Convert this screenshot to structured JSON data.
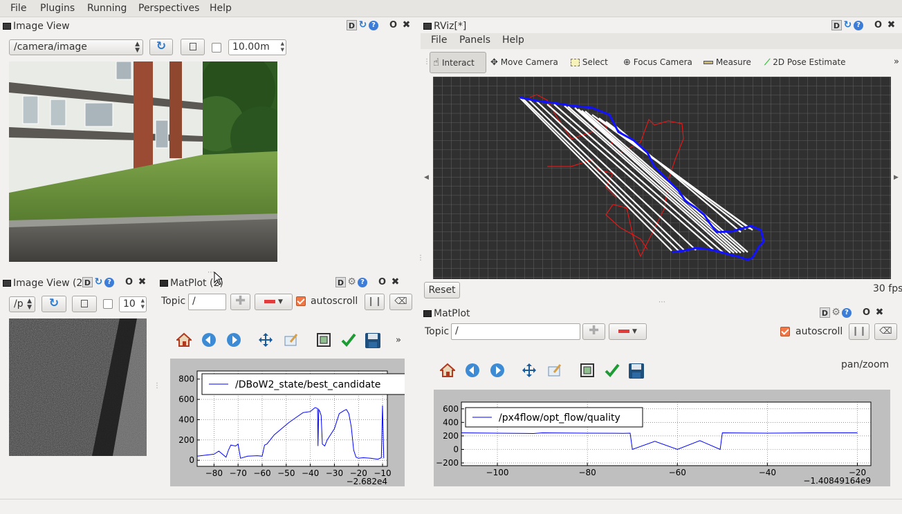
{
  "menubar": {
    "items": [
      "File",
      "Plugins",
      "Running",
      "Perspectives",
      "Help"
    ]
  },
  "image_view_1": {
    "title": "Image View",
    "topic": "/camera/image",
    "scale_value": "10.00m",
    "refresh_icon": "refresh-icon"
  },
  "image_view_2": {
    "title": "Image View (2)",
    "topic": "/p",
    "scale_value": "10"
  },
  "matplot_1": {
    "title": "MatPlot (2)",
    "topic_label": "Topic",
    "topic_value": "/",
    "autoscroll_label": "autoscroll",
    "more": "»",
    "x_offset_label": "−2.682e4"
  },
  "matplot_2": {
    "title": "MatPlot",
    "topic_label": "Topic",
    "topic_value": "/",
    "autoscroll_label": "autoscroll",
    "mode_label": "pan/zoom",
    "x_offset_label": "−1.40849164e9"
  },
  "rviz": {
    "title": "RViz[*]",
    "menu": [
      "File",
      "Panels",
      "Help"
    ],
    "tools": [
      "Interact",
      "Move Camera",
      "Select",
      "Focus Camera",
      "Measure",
      "2D Pose Estimate"
    ],
    "more": "»",
    "reset_label": "Reset",
    "fps": "30 fps"
  },
  "title_buttons": {
    "d": "D",
    "q": "?",
    "o": "O",
    "x": "✖"
  },
  "colors": {
    "series": "#0000ff",
    "grid": "#555555",
    "accent": "#f07746",
    "rviz_bg": "#303030"
  },
  "chart_data": [
    {
      "type": "line",
      "series": [
        {
          "name": "/DBoW2_state/best_candidate",
          "x": [
            -87,
            -80,
            -78,
            -75,
            -74,
            -73,
            -71,
            -70,
            -69,
            -66,
            -62,
            -60,
            -59,
            -58,
            -55,
            -52,
            -49,
            -46,
            -43,
            -40,
            -39,
            -38,
            -37,
            -36.8,
            -36.5,
            -36,
            -35.5,
            -35,
            -34,
            -33,
            -30,
            -28,
            -26,
            -25,
            -24,
            -23,
            -22,
            -21,
            -20,
            -18,
            -15,
            -12,
            -10.5,
            -10,
            -9.5
          ],
          "y": [
            40,
            60,
            90,
            30,
            100,
            150,
            140,
            160,
            20,
            40,
            45,
            40,
            150,
            160,
            250,
            310,
            370,
            420,
            470,
            480,
            500,
            520,
            510,
            140,
            500,
            480,
            440,
            160,
            140,
            200,
            310,
            460,
            490,
            500,
            460,
            330,
            100,
            30,
            20,
            25,
            20,
            10,
            25,
            540,
            20
          ]
        }
      ],
      "xticks": [
        -80,
        -70,
        -60,
        -50,
        -40,
        -30,
        -20,
        -10
      ],
      "yticks": [
        0,
        200,
        400,
        600,
        800
      ],
      "xlim": [
        -87,
        -8
      ],
      "ylim": [
        -60,
        880
      ],
      "grid": true,
      "legend": "top"
    },
    {
      "type": "line",
      "series": [
        {
          "name": "/px4flow/opt_flow/quality",
          "x": [
            -108,
            -100,
            -92,
            -90,
            -80,
            -72,
            -70.5,
            -70,
            -65,
            -60,
            -55,
            -50.5,
            -50,
            -40,
            -30,
            -20
          ],
          "y": [
            245,
            240,
            235,
            245,
            240,
            238,
            240,
            0,
            120,
            0,
            130,
            0,
            245,
            240,
            245,
            245
          ]
        }
      ],
      "xticks": [
        -100,
        -80,
        -60,
        -40,
        -20
      ],
      "yticks": [
        -200,
        0,
        200,
        400,
        600
      ],
      "xlim": [
        -108,
        -17
      ],
      "ylim": [
        -240,
        700
      ],
      "grid": true,
      "legend": "top-left"
    }
  ]
}
